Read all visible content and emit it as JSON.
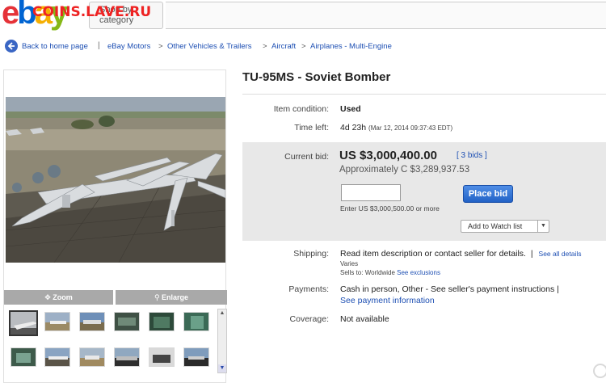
{
  "header": {
    "logo": [
      "e",
      "b",
      "a",
      "y"
    ],
    "watermark": "COINS.LAVE.RU",
    "category_button": [
      "Shop by",
      "category"
    ]
  },
  "breadcrumb": {
    "back_label": "Back to home page",
    "sep": "|",
    "items": [
      "eBay Motors",
      "Other Vehicles & Trailers",
      "Aircraft",
      "Airplanes - Multi-Engine"
    ],
    "arrow": ">"
  },
  "gallery": {
    "zoom_label": "Zoom",
    "enlarge_label": "Enlarge",
    "thumb_count": 12
  },
  "item": {
    "title": "TU-95MS - Soviet Bomber",
    "condition_label": "Item condition:",
    "condition_value": "Used",
    "time_left_label": "Time left:",
    "time_left_value": "4d 23h",
    "time_left_date": "(Mar 12, 2014  09:37:43 EDT)",
    "current_bid_label": "Current bid:",
    "current_bid_value": "US $3,000,400.00",
    "bids_link": "[ 3 bids ]",
    "approx": "Approximately C $3,289,937.53",
    "bid_input_value": "",
    "place_bid_label": "Place bid",
    "enter_note": "Enter US $3,000,500.00 or more",
    "watch_label": "Add to Watch list",
    "shipping_label": "Shipping:",
    "shipping_value": "Read item description or contact seller for details.",
    "shipping_sep": "|",
    "see_all_details": "See all details",
    "shipping_varies": "Varies",
    "sells_to_prefix": "Sells to:",
    "sells_to_value": "Worldwide",
    "see_exclusions": "See exclusions",
    "payments_label": "Payments:",
    "payments_value": "Cash in person, Other - See seller's payment instructions |",
    "see_payment_info": "See payment information",
    "coverage_label": "Coverage:",
    "coverage_value": "Not available"
  }
}
